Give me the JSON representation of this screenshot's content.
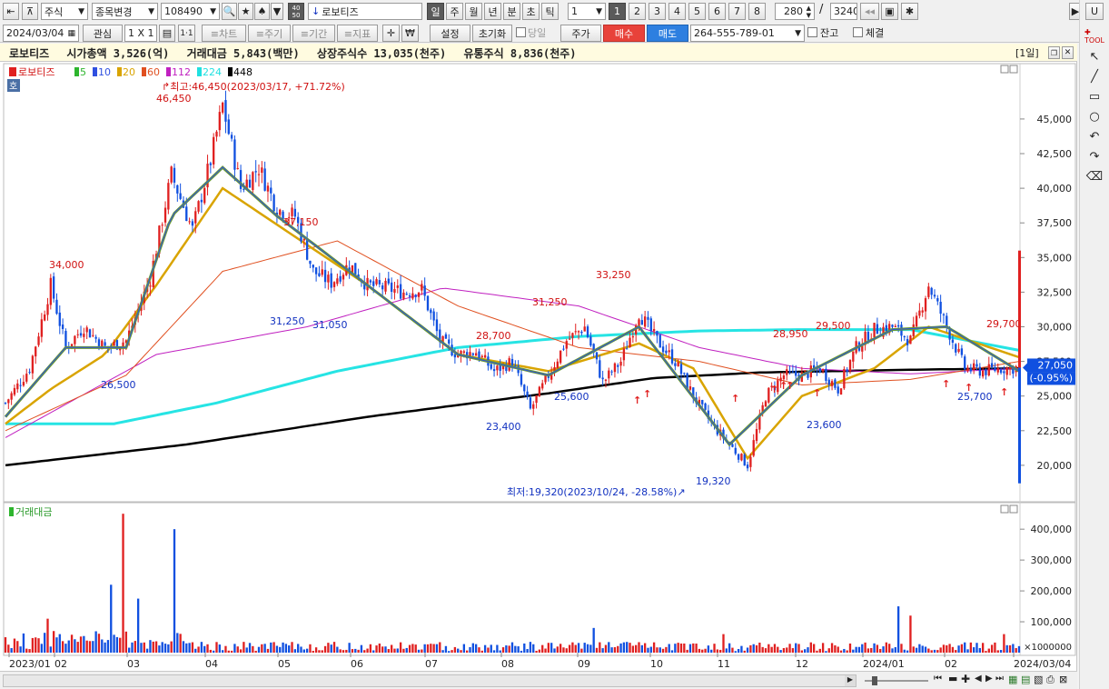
{
  "toolbar1": {
    "left_icons": [
      "collapse-icon",
      "pin-icon"
    ],
    "market": "주식",
    "change_item": "종목변경",
    "code": "108490",
    "name": "로보티즈",
    "period_buttons": [
      "일",
      "주",
      "월",
      "년",
      "분",
      "초",
      "틱"
    ],
    "period_active": "일",
    "interval": "1",
    "pages": [
      "1",
      "2",
      "3",
      "4",
      "5",
      "6",
      "7",
      "8"
    ],
    "page_active": "1",
    "count": "280",
    "slash": "/",
    "total": "3240",
    "u_label": "U"
  },
  "toolbar2": {
    "date": "2024/03/04",
    "watch": "관심",
    "grid": "1 X 1",
    "onebyone": "1·1",
    "chart": "≡차트",
    "cycle": "≡주기",
    "period": "≡기간",
    "indicator": "≡지표",
    "setting": "설정",
    "reset": "초기화",
    "today": "당일",
    "price": "주가",
    "buy": "매수",
    "sell": "매도",
    "account": "264-555-789-01",
    "balance": "잔고",
    "executed": "체결"
  },
  "info": {
    "name": "로보티즈",
    "cap": "시가총액 3,526(억)",
    "amount": "거래대금 5,843(백만)",
    "listed": "상장주식수 13,035(천주)",
    "float": "유통주식 8,836(천주)",
    "period_tag": "[1일]"
  },
  "legend": {
    "stock": "로보티즈",
    "ma": [
      {
        "label": "5",
        "color": "#2db52d"
      },
      {
        "label": "10",
        "color": "#3050e0"
      },
      {
        "label": "20",
        "color": "#d9a400"
      },
      {
        "label": "60",
        "color": "#e05020"
      },
      {
        "label": "112",
        "color": "#c020c0"
      },
      {
        "label": "224",
        "color": "#20e0e0"
      },
      {
        "label": "448",
        "color": "#000000"
      }
    ],
    "volume": "거래대금",
    "ho": "호"
  },
  "annotations": {
    "high": "최고:46,450(2023/03/17, +71.72%)",
    "low": "최저:19,320(2023/10/24, -28.58%)",
    "current": "27,050",
    "current_change": "(-0.95%)",
    "points": [
      {
        "t": "46,450",
        "c": "#d01010"
      },
      {
        "t": "34,000",
        "c": "#d01010"
      },
      {
        "t": "26,500",
        "c": "#1030c0"
      },
      {
        "t": "37,150",
        "c": "#d01010"
      },
      {
        "t": "31,250",
        "c": "#1030c0"
      },
      {
        "t": "31,050",
        "c": "#1030c0"
      },
      {
        "t": "28,700",
        "c": "#d01010"
      },
      {
        "t": "23,400",
        "c": "#1030c0"
      },
      {
        "t": "31,250",
        "c": "#d01010"
      },
      {
        "t": "25,600",
        "c": "#1030c0"
      },
      {
        "t": "33,250",
        "c": "#d01010"
      },
      {
        "t": "19,320",
        "c": "#1030c0"
      },
      {
        "t": "28,950",
        "c": "#d01010"
      },
      {
        "t": "23,600",
        "c": "#1030c0"
      },
      {
        "t": "29,500",
        "c": "#d01010"
      },
      {
        "t": "25,700",
        "c": "#1030c0"
      },
      {
        "t": "29,700",
        "c": "#d01010"
      }
    ]
  },
  "chart_data": {
    "type": "candlestick",
    "price_axis": {
      "ticks": [
        "45,000",
        "42,500",
        "40,000",
        "37,500",
        "35,000",
        "32,500",
        "30,000",
        "27,500",
        "25,000",
        "22,500",
        "20,000"
      ],
      "range": [
        17500,
        48800
      ]
    },
    "volume_axis": {
      "ticks": [
        "400,000",
        "300,000",
        "200,000",
        "100,000"
      ],
      "unit": "×1000000",
      "range": [
        0,
        480000
      ]
    },
    "x_ticks": [
      "2023/01",
      "02",
      "03",
      "04",
      "05",
      "06",
      "07",
      "08",
      "09",
      "10",
      "11",
      "12",
      "2024/01",
      "02",
      "2024/03/04"
    ],
    "price_path": [
      [
        0,
        24500
      ],
      [
        8,
        27000
      ],
      [
        15,
        33000
      ],
      [
        20,
        28500
      ],
      [
        26,
        30000
      ],
      [
        33,
        28500
      ],
      [
        40,
        29000
      ],
      [
        48,
        33500
      ],
      [
        55,
        41000
      ],
      [
        62,
        37000
      ],
      [
        68,
        42000
      ],
      [
        72,
        46000
      ],
      [
        78,
        40000
      ],
      [
        84,
        41500
      ],
      [
        90,
        38500
      ],
      [
        96,
        38000
      ],
      [
        102,
        34000
      ],
      [
        108,
        33200
      ],
      [
        114,
        34500
      ],
      [
        120,
        33000
      ],
      [
        126,
        32800
      ],
      [
        132,
        32500
      ],
      [
        138,
        32700
      ],
      [
        144,
        29000
      ],
      [
        150,
        28000
      ],
      [
        156,
        28200
      ],
      [
        162,
        26800
      ],
      [
        168,
        27500
      ],
      [
        174,
        24000
      ],
      [
        180,
        26500
      ],
      [
        186,
        29000
      ],
      [
        192,
        30000
      ],
      [
        198,
        26000
      ],
      [
        204,
        27500
      ],
      [
        210,
        31000
      ],
      [
        216,
        29000
      ],
      [
        222,
        27500
      ],
      [
        228,
        25000
      ],
      [
        234,
        23000
      ],
      [
        240,
        21500
      ],
      [
        246,
        20000
      ],
      [
        252,
        25000
      ],
      [
        258,
        26500
      ],
      [
        264,
        26500
      ],
      [
        270,
        27000
      ],
      [
        276,
        25500
      ],
      [
        282,
        28500
      ],
      [
        288,
        29800
      ],
      [
        294,
        30000
      ],
      [
        300,
        29000
      ],
      [
        306,
        33000
      ],
      [
        312,
        30000
      ],
      [
        318,
        27000
      ],
      [
        324,
        26800
      ],
      [
        330,
        27000
      ],
      [
        336,
        27050
      ]
    ],
    "ma_paths": {
      "ma5": [
        [
          0,
          23500
        ],
        [
          20,
          28500
        ],
        [
          40,
          28500
        ],
        [
          55,
          38000
        ],
        [
          72,
          41500
        ],
        [
          90,
          38000
        ],
        [
          120,
          33000
        ],
        [
          150,
          28000
        ],
        [
          180,
          26500
        ],
        [
          210,
          30000
        ],
        [
          240,
          21500
        ],
        [
          264,
          26500
        ],
        [
          294,
          29800
        ],
        [
          312,
          30000
        ],
        [
          336,
          26800
        ]
      ],
      "ma20": [
        [
          0,
          23000
        ],
        [
          15,
          25500
        ],
        [
          33,
          28000
        ],
        [
          50,
          33000
        ],
        [
          72,
          40000
        ],
        [
          96,
          36500
        ],
        [
          120,
          33000
        ],
        [
          150,
          28000
        ],
        [
          180,
          26800
        ],
        [
          210,
          28800
        ],
        [
          228,
          27000
        ],
        [
          246,
          20500
        ],
        [
          264,
          25000
        ],
        [
          288,
          27000
        ],
        [
          306,
          30000
        ],
        [
          336,
          27800
        ]
      ],
      "ma60": [
        [
          0,
          22500
        ],
        [
          40,
          26500
        ],
        [
          72,
          34000
        ],
        [
          110,
          36200
        ],
        [
          150,
          31500
        ],
        [
          190,
          28500
        ],
        [
          230,
          27500
        ],
        [
          264,
          25800
        ],
        [
          300,
          26200
        ],
        [
          336,
          27500
        ]
      ],
      "ma112": [
        [
          0,
          22000
        ],
        [
          50,
          28000
        ],
        [
          100,
          30000
        ],
        [
          145,
          32800
        ],
        [
          190,
          31500
        ],
        [
          230,
          28500
        ],
        [
          264,
          27000
        ],
        [
          300,
          26600
        ],
        [
          336,
          27000
        ]
      ],
      "ma224": [
        [
          0,
          23000
        ],
        [
          36,
          23000
        ],
        [
          70,
          24500
        ],
        [
          110,
          26800
        ],
        [
          150,
          28500
        ],
        [
          190,
          29300
        ],
        [
          230,
          29700
        ],
        [
          264,
          29800
        ],
        [
          300,
          29800
        ],
        [
          336,
          28300
        ]
      ],
      "ma448": [
        [
          0,
          20000
        ],
        [
          60,
          21500
        ],
        [
          120,
          23500
        ],
        [
          180,
          25200
        ],
        [
          215,
          26300
        ],
        [
          250,
          26700
        ],
        [
          300,
          26900
        ],
        [
          336,
          27000
        ]
      ]
    },
    "volume_spikes": [
      [
        35,
        220000
      ],
      [
        39,
        450000
      ],
      [
        44,
        175000
      ],
      [
        56,
        400000
      ],
      [
        14,
        110000
      ],
      [
        16,
        70000
      ],
      [
        18,
        60000
      ],
      [
        195,
        80000
      ],
      [
        238,
        60000
      ],
      [
        296,
        150000
      ],
      [
        300,
        120000
      ],
      [
        331,
        60000
      ]
    ]
  },
  "bottom": {
    "zoom_minus": "▬",
    "zoom_plus": "✚"
  }
}
